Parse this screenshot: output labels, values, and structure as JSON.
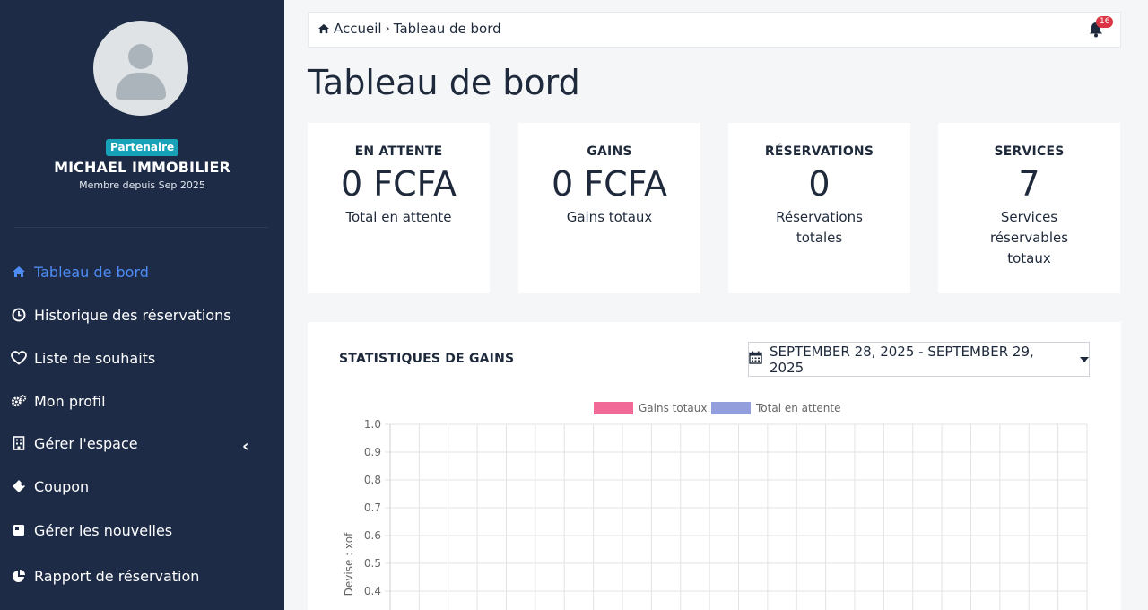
{
  "sidebar": {
    "role_badge": "Partenaire",
    "user_name": "MICHAEL IMMOBILIER",
    "member_since": "Membre depuis Sep 2025",
    "items": [
      {
        "label": "Tableau de bord",
        "icon": "home-icon",
        "active": true
      },
      {
        "label": "Historique des réservations",
        "icon": "clock-icon"
      },
      {
        "label": "Liste de souhaits",
        "icon": "heart-icon"
      },
      {
        "label": "Mon profil",
        "icon": "cogs-icon"
      },
      {
        "label": "Gérer l'espace",
        "icon": "building-icon",
        "has_submenu": true
      },
      {
        "label": "Coupon",
        "icon": "ticket-icon"
      },
      {
        "label": "Gérer les nouvelles",
        "icon": "book-icon"
      },
      {
        "label": "Rapport de réservation",
        "icon": "pie-chart-icon"
      }
    ]
  },
  "header": {
    "breadcrumb_home": "Accueil",
    "breadcrumb_current": "Tableau de bord",
    "notification_count": "16"
  },
  "page_title": "Tableau de bord",
  "stats": [
    {
      "label": "EN ATTENTE",
      "value": "0 FCFA",
      "sub": "Total en attente"
    },
    {
      "label": "GAINS",
      "value": "0 FCFA",
      "sub": "Gains totaux"
    },
    {
      "label": "RÉSERVATIONS",
      "value": "0",
      "sub": "Réservations totales"
    },
    {
      "label": "SERVICES",
      "value": "7",
      "sub": "Services réservables totaux"
    }
  ],
  "earnings_panel": {
    "heading": "STATISTIQUES DE GAINS",
    "date_range": "SEPTEMBER 28, 2025 - SEPTEMBER 29, 2025"
  },
  "chart_data": {
    "type": "bar",
    "ylabel": "Devise : xof",
    "xlabel": "",
    "ylim": [
      0,
      1
    ],
    "y_ticks": [
      "1.0",
      "0.9",
      "0.8",
      "0.7",
      "0.6",
      "0.5",
      "0.4"
    ],
    "grid": true,
    "legend_position": "top",
    "series": [
      {
        "name": "Gains totaux",
        "color": "#f06292",
        "values": []
      },
      {
        "name": "Total en attente",
        "color": "#8e99dc",
        "values": []
      }
    ]
  },
  "colors": {
    "sidebar_bg": "#1d2b46",
    "active_nav": "#4d8cf5",
    "badge": "#17a2b8",
    "notification": "#dc3545"
  }
}
